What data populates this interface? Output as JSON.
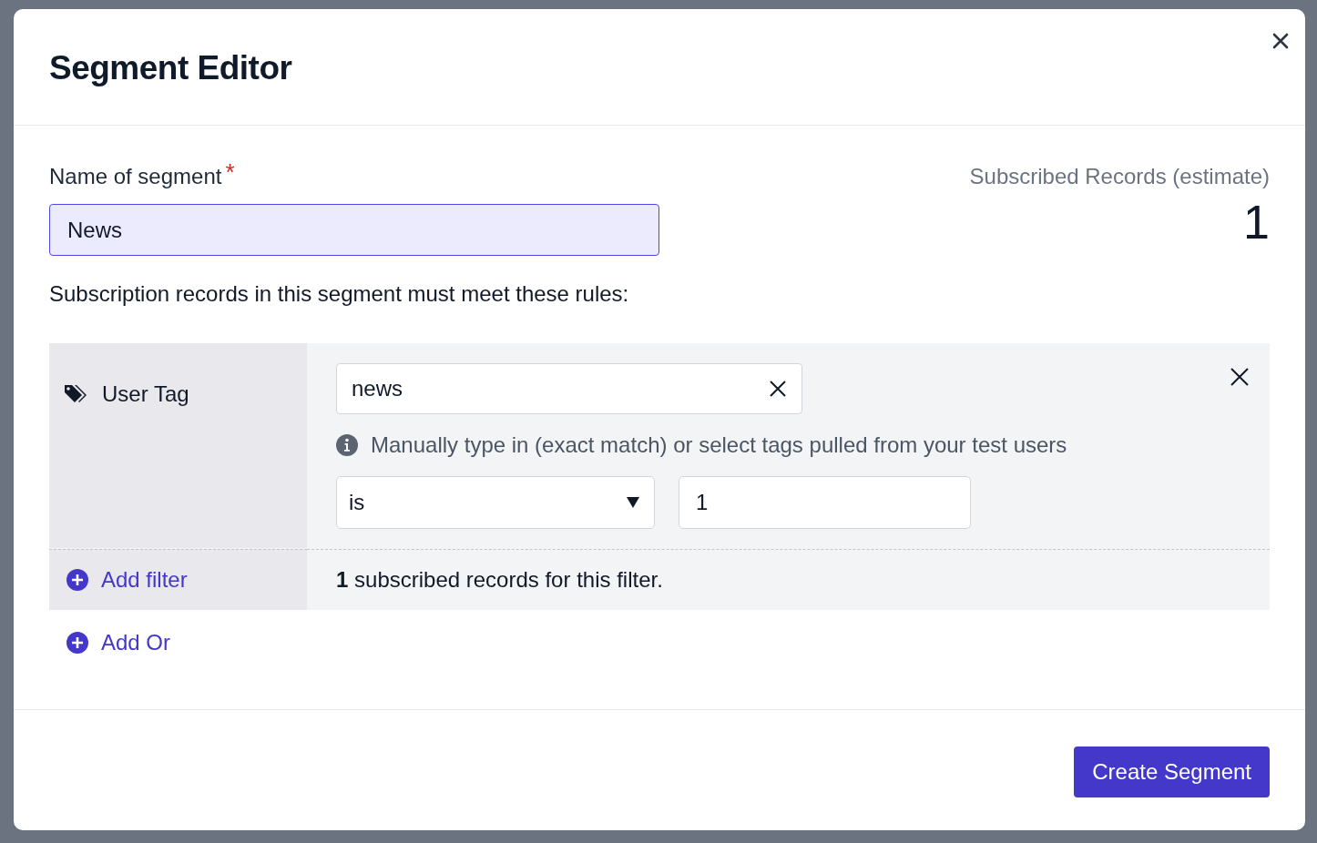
{
  "modal": {
    "title": "Segment Editor"
  },
  "name_field": {
    "label": "Name of segment",
    "required_mark": "*",
    "value": "News"
  },
  "estimate": {
    "label": "Subscribed Records (estimate)",
    "value": "1"
  },
  "rules_intro": "Subscription records in this segment must meet these rules:",
  "filter": {
    "type_label": "User Tag",
    "tag_value": "news",
    "hint": "Manually type in (exact match) or select tags pulled from your test users",
    "operator": "is",
    "operand": "1",
    "add_filter": "Add filter",
    "count": "1",
    "count_text": "subscribed records for this filter."
  },
  "add_or": "Add Or",
  "create_button": "Create Segment"
}
